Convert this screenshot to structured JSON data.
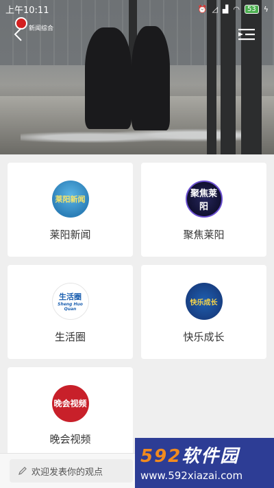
{
  "status_bar": {
    "time": "上午10:11",
    "battery": "53"
  },
  "video": {
    "channel_text": "新闻综合"
  },
  "cards": [
    {
      "label": "莱阳新闻",
      "logo_text": "莱阳新闻"
    },
    {
      "label": "聚焦莱阳",
      "logo_text": "聚焦莱阳"
    },
    {
      "label": "生活圈",
      "logo_text": "生活圈",
      "logo_subtext": "Sheng Huo Quan"
    },
    {
      "label": "快乐成长",
      "logo_text": "快乐成长"
    },
    {
      "label": "晚会视频",
      "logo_text": "晚会视频"
    }
  ],
  "comment": {
    "placeholder": "欢迎发表你的观点"
  },
  "watermark": {
    "brand_num": "592",
    "brand_text": "软件园",
    "url": "www.592xiazai.com"
  },
  "colors": {
    "watermark_bg": "#2d3d95",
    "watermark_accent": "#f28b1e",
    "gala_red": "#c8202a"
  }
}
